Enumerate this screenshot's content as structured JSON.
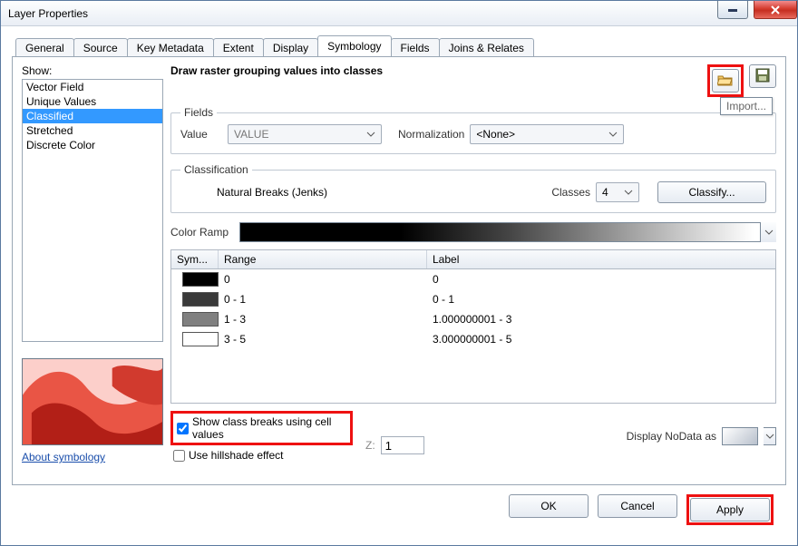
{
  "window": {
    "title": "Layer Properties"
  },
  "tabs": {
    "items": [
      "General",
      "Source",
      "Key Metadata",
      "Extent",
      "Display",
      "Symbology",
      "Fields",
      "Joins & Relates"
    ],
    "active": 5
  },
  "sidebar": {
    "label": "Show:",
    "items": [
      "Vector Field",
      "Unique Values",
      "Classified",
      "Stretched",
      "Discrete Color"
    ],
    "selected": 2,
    "about_link": "About symbology"
  },
  "main": {
    "heading": "Draw raster grouping values into classes",
    "import_tooltip": "Import...",
    "icons": {
      "open": "open-folder-icon",
      "save": "save-icon"
    },
    "fields": {
      "legend": "Fields",
      "value_label": "Value",
      "value_selected": "VALUE",
      "normalization_label": "Normalization",
      "normalization_selected": "<None>"
    },
    "classification": {
      "legend": "Classification",
      "method": "Natural Breaks (Jenks)",
      "classes_label": "Classes",
      "classes_value": "4",
      "classify_button": "Classify..."
    },
    "color_ramp_label": "Color Ramp",
    "grid": {
      "headers": {
        "sym": "Sym...",
        "range": "Range",
        "label": "Label"
      },
      "rows": [
        {
          "color": "#000000",
          "range": "0",
          "label": "0"
        },
        {
          "color": "#3a3a3a",
          "range": "0 - 1",
          "label": "0 - 1"
        },
        {
          "color": "#808080",
          "range": "1 - 3",
          "label": "1.000000001 - 3"
        },
        {
          "color": "#ffffff",
          "range": "3 - 5",
          "label": "3.000000001 - 5"
        }
      ]
    },
    "options": {
      "show_cell_values": "Show class breaks using cell values",
      "hillshade": "Use hillshade effect",
      "z_label": "Z:",
      "z_value": "1",
      "nodata_label": "Display NoData as"
    }
  },
  "buttons": {
    "ok": "OK",
    "cancel": "Cancel",
    "apply": "Apply"
  }
}
